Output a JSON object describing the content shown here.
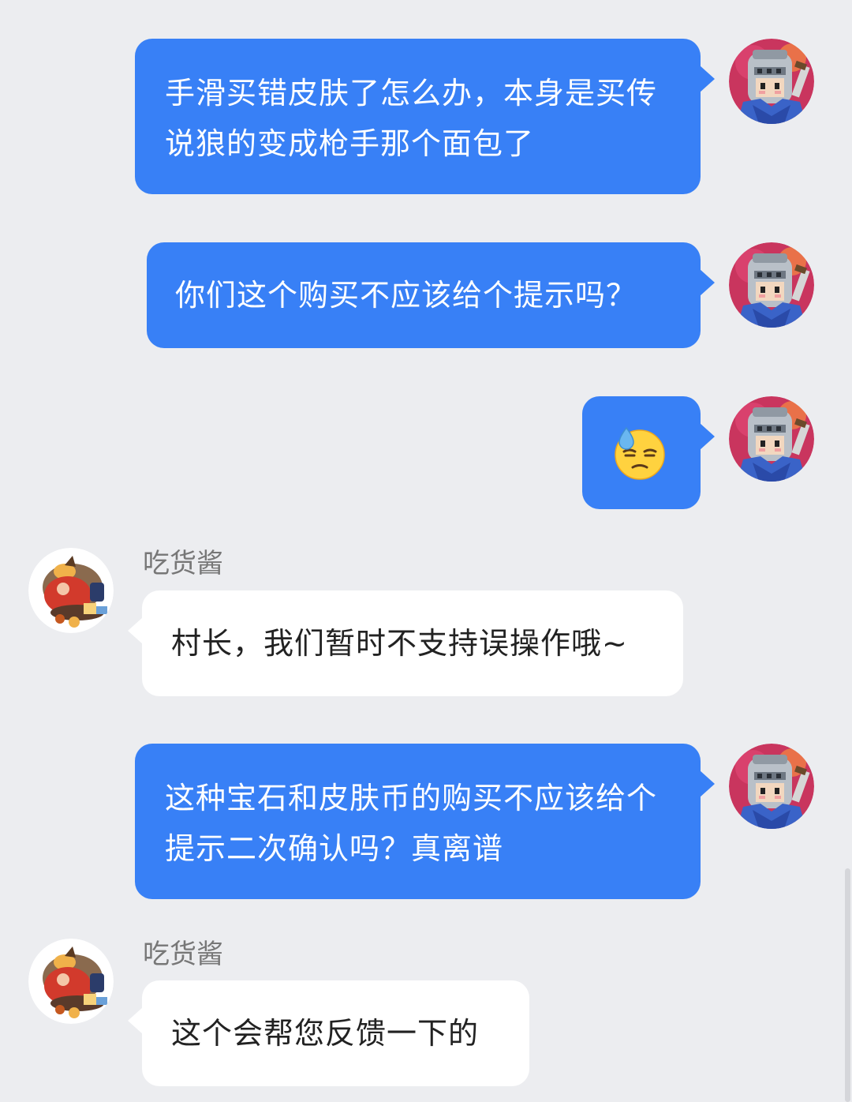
{
  "messages": [
    {
      "from": "me",
      "text": "手滑买错皮肤了怎么办，本身是买传说狼的变成枪手那个面包了"
    },
    {
      "from": "me",
      "text": "你们这个购买不应该给个提示吗？"
    },
    {
      "from": "me",
      "emoji": "😓",
      "emoji_name": "downcast-face-with-sweat"
    },
    {
      "from": "them",
      "sender": "吃货酱",
      "text": "村长，我们暂时不支持误操作哦~"
    },
    {
      "from": "me",
      "text": "这种宝石和皮肤币的购买不应该给个提示二次确认吗？真离谱"
    },
    {
      "from": "them",
      "sender": "吃货酱",
      "text": "这个会帮您反馈一下的"
    }
  ],
  "colors": {
    "background": "#ecedf0",
    "my_bubble": "#3880f6",
    "their_bubble": "#ffffff",
    "sender_name": "#777777"
  },
  "icons": {
    "my_avatar": "knight-avatar-icon",
    "their_avatar": "foodie-avatar-icon"
  }
}
